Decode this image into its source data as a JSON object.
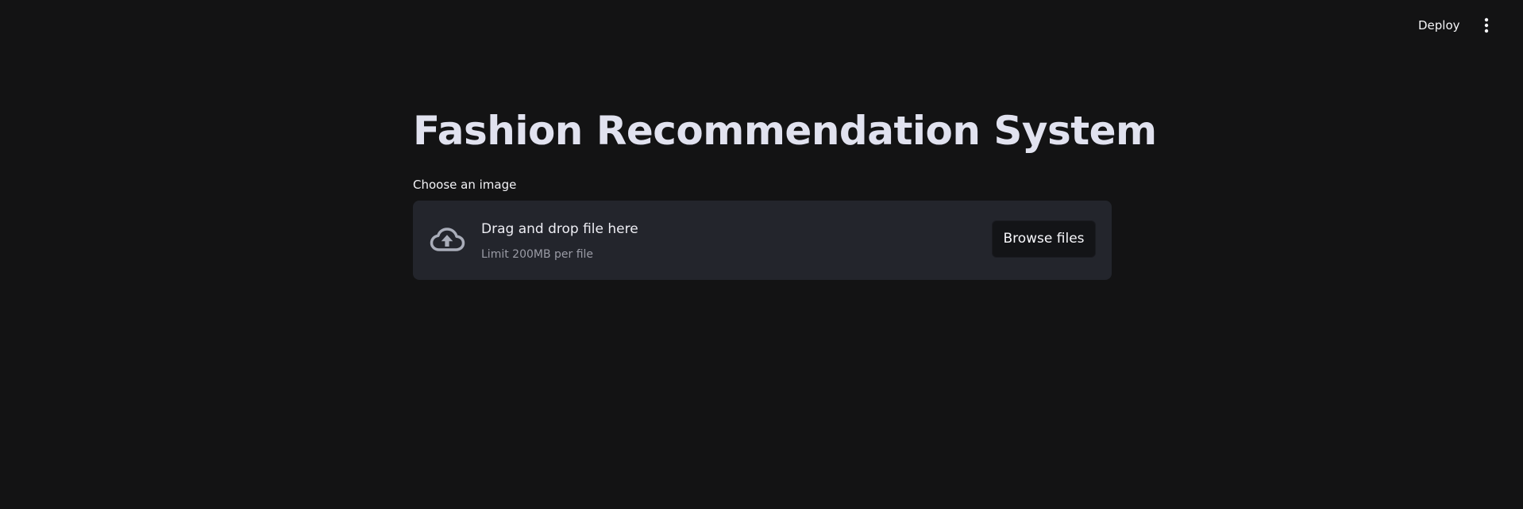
{
  "header": {
    "deploy_label": "Deploy",
    "menu_icon": "vertical-ellipsis-icon"
  },
  "main": {
    "title": "Fashion Recommendation System",
    "uploader": {
      "label": "Choose an image",
      "drop_title": "Drag and drop file here",
      "limit_text": "Limit 200MB per file",
      "browse_label": "Browse files",
      "icon": "cloud-upload-icon"
    }
  },
  "colors": {
    "background": "#131314",
    "dropzone": "#23252c",
    "title": "#e1e2ef",
    "muted_text": "#9a9ba5",
    "icon": "#a9adb9"
  }
}
